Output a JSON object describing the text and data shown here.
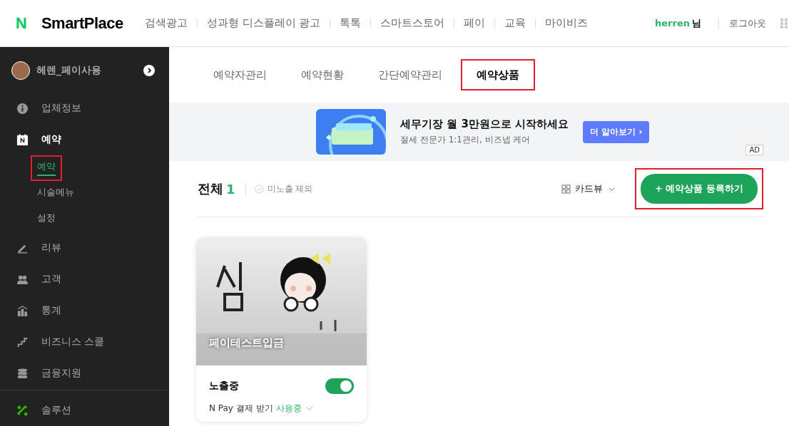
{
  "header": {
    "logo_mark": "N",
    "logo_text": "SmartPlace",
    "nav": [
      "검색광고",
      "성과형 디스플레이 광고",
      "톡톡",
      "스마트스토어",
      "페이",
      "교육",
      "마이비즈"
    ],
    "user": "herren",
    "user_suffix": "님",
    "logout": "로그아웃"
  },
  "sidebar": {
    "account": "헤렌_페이사용",
    "items": [
      {
        "label": "업체정보",
        "selected": false
      },
      {
        "label": "예약",
        "selected": true,
        "children": [
          {
            "label": "예약",
            "selected": true,
            "highlighted": true
          },
          {
            "label": "시술메뉴",
            "selected": false,
            "highlighted": false
          },
          {
            "label": "설정",
            "selected": false,
            "highlighted": false
          }
        ]
      },
      {
        "label": "리뷰",
        "selected": false
      },
      {
        "label": "고객",
        "selected": false
      },
      {
        "label": "통계",
        "selected": false
      },
      {
        "label": "비즈니스 스쿨",
        "selected": false
      },
      {
        "label": "금융지원",
        "selected": false
      }
    ],
    "footer_item": {
      "label": "솔루션"
    }
  },
  "tabs": [
    {
      "label": "예약자관리",
      "selected": false,
      "highlighted": false
    },
    {
      "label": "예약현황",
      "selected": false,
      "highlighted": false
    },
    {
      "label": "간단예약관리",
      "selected": false,
      "highlighted": false
    },
    {
      "label": "예약상품",
      "selected": true,
      "highlighted": true
    }
  ],
  "ad": {
    "title": "세무기장 월 3만원으로 시작하세요",
    "subtitle": "절세 전문가 1:1관리, 비즈넵 케어",
    "button": "더 알아보기 ›",
    "badge": "AD"
  },
  "toolbar": {
    "total_label": "전체",
    "total_count": "1",
    "filter": "미노출 제외",
    "filter_checked": false,
    "view": "카드뷰",
    "register_button": "+ 예약상품 등록하기",
    "register_highlighted": true
  },
  "products": [
    {
      "title": "페이테스트입금",
      "status": "노출중",
      "on": true,
      "npay_label": "N Pay 결제 받기",
      "npay_status": "사용중"
    }
  ]
}
